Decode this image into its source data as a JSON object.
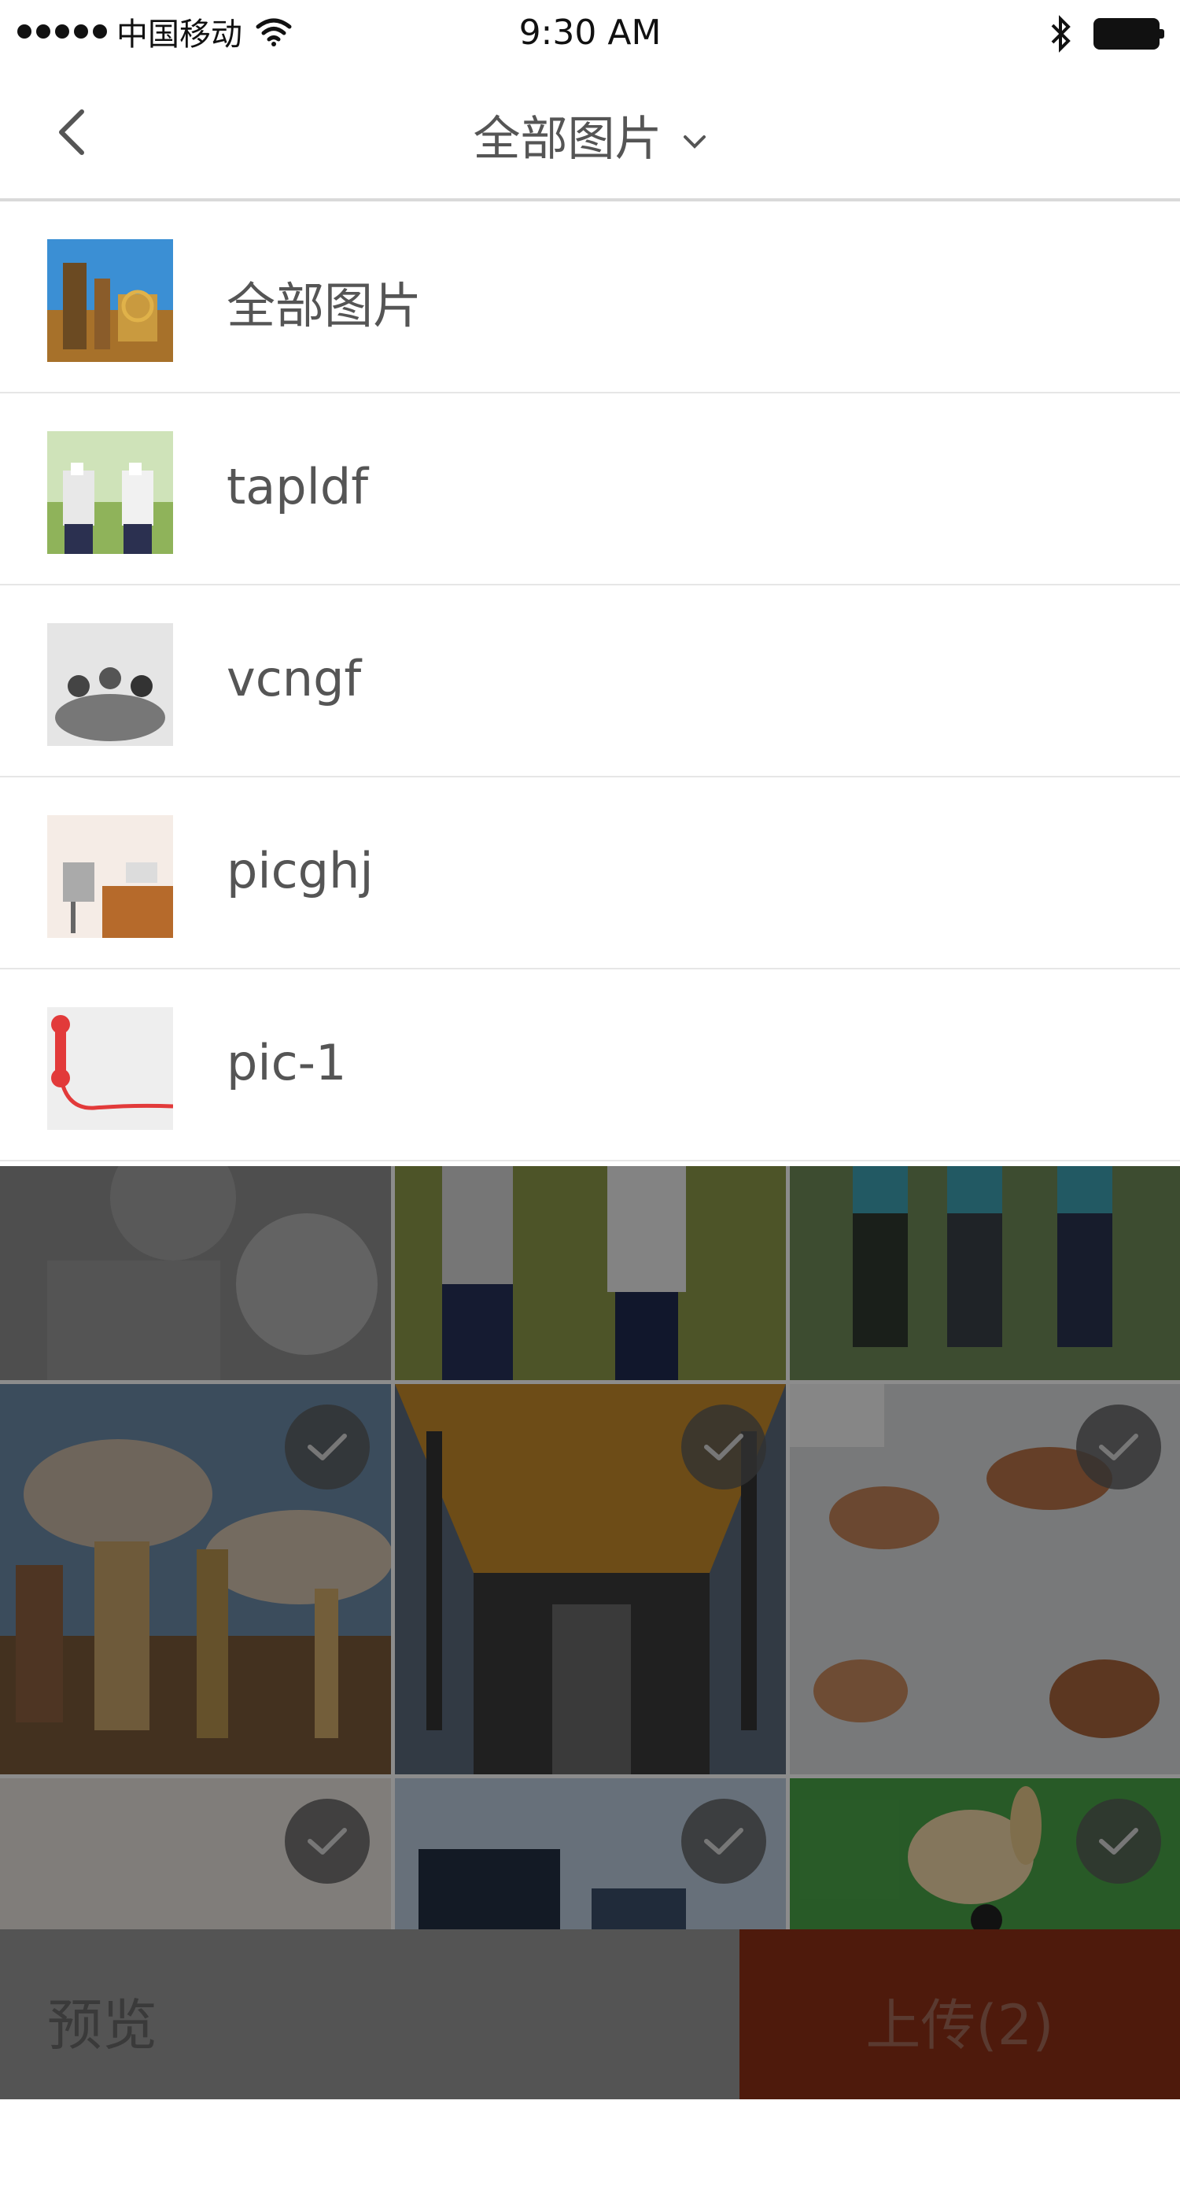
{
  "status_bar": {
    "carrier": "中国移动",
    "time": "9:30 AM",
    "icons": [
      "signal-dots-icon",
      "wifi-icon",
      "bluetooth-icon",
      "battery-icon"
    ]
  },
  "nav": {
    "back_icon": "chevron-left-icon",
    "title": "全部图片",
    "dropdown_icon": "chevron-down-icon"
  },
  "albums": [
    {
      "label": "全部图片",
      "thumb": "industrial-plant-blue-sky"
    },
    {
      "label": "tapldf",
      "thumb": "people-holding-check-signs"
    },
    {
      "label": "vcngf",
      "thumb": "team-hands-together-bw"
    },
    {
      "label": "picghj",
      "thumb": "office-desk-chair"
    },
    {
      "label": "pic-1",
      "thumb": "red-telephone"
    }
  ],
  "grid": {
    "selected_icon": "check-circle-icon",
    "photos": [
      {
        "name": "volunteer-smiling",
        "checked": false
      },
      {
        "name": "people-standing-grass",
        "checked": false
      },
      {
        "name": "group-walking-field",
        "checked": false
      },
      {
        "name": "power-plant-cooling-towers",
        "checked": true
      },
      {
        "name": "factory-interior",
        "checked": true
      },
      {
        "name": "hands-clapping",
        "checked": true
      },
      {
        "name": "blank-paper",
        "checked": true
      },
      {
        "name": "building-construction",
        "checked": true
      },
      {
        "name": "green-illustration",
        "checked": true
      }
    ]
  },
  "bottom": {
    "preview_label": "预览",
    "upload_label": "上传(2)"
  },
  "colors": {
    "accent": "#4e1a0c",
    "divider": "#e6e6e6"
  }
}
